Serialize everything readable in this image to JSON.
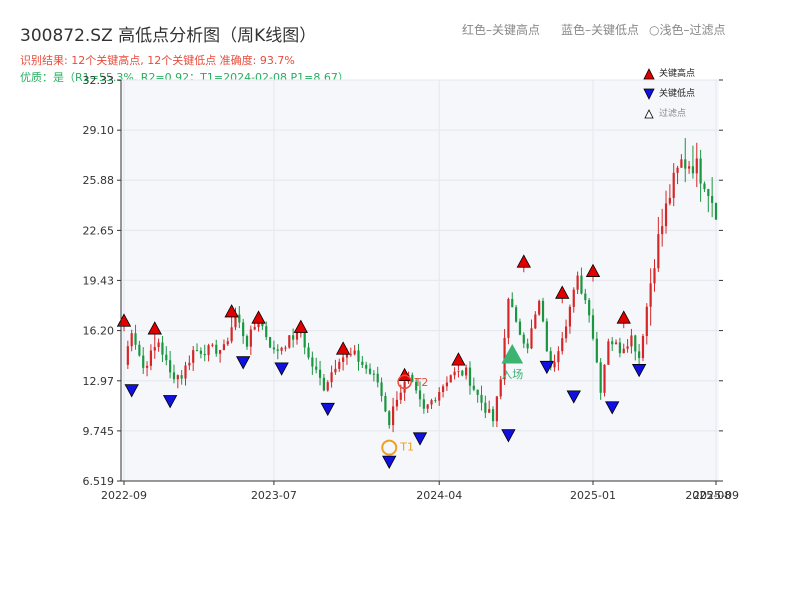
{
  "title": "300872.SZ 高低点分析图（周K线图）",
  "subtitle_result": "识别结果: 12个关键高点, 12个关键低点   准确度: 93.7%",
  "subtitle_quality": "优质：是（R1=55.3%, R2=0.92；T1=2024-02-08 P1=8.67）",
  "top_legend": {
    "red": "红色–关键高点",
    "blue": "蓝色–关键低点",
    "light": "○浅色–过滤点"
  },
  "legend": {
    "high": "关键高点",
    "low": "关键低点",
    "filtered": "过滤点"
  },
  "annotations": {
    "t1": "T1",
    "t2": "T2",
    "entry": "入场"
  },
  "colors": {
    "up": "#d62728",
    "down": "#1a9641",
    "high_marker": "#e00000",
    "low_marker": "#1010e0",
    "entry": "#3cb371",
    "t_marker": "#f0a020",
    "plot_bg": "#f5f7fa"
  },
  "chart_data": {
    "type": "candlestick",
    "x_ticks": [
      "2022-09",
      "2023-07",
      "2024-04",
      "2025-01",
      "2025-09"
    ],
    "y_ticks": [
      "6.519",
      "9.745",
      "12.97",
      "16.20",
      "19.43",
      "22.65",
      "25.88",
      "29.10",
      "32.33"
    ],
    "ylim": [
      6.519,
      32.33
    ],
    "weeks": 154,
    "close_path": [
      [
        0,
        14.0
      ],
      [
        2,
        16.3
      ],
      [
        5,
        13.8
      ],
      [
        9,
        15.5
      ],
      [
        12,
        13.4
      ],
      [
        15,
        13.3
      ],
      [
        18,
        14.9
      ],
      [
        26,
        15.0
      ],
      [
        29,
        17.2
      ],
      [
        32,
        15.4
      ],
      [
        35,
        17.0
      ],
      [
        39,
        14.8
      ],
      [
        46,
        16.2
      ],
      [
        48,
        14.4
      ],
      [
        52,
        12.6
      ],
      [
        56,
        14.5
      ],
      [
        60,
        14.6
      ],
      [
        66,
        12.9
      ],
      [
        69,
        10.3
      ],
      [
        71,
        12.0
      ],
      [
        74,
        13.1
      ],
      [
        78,
        11.0
      ],
      [
        85,
        13.4
      ],
      [
        89,
        13.5
      ],
      [
        92,
        12.0
      ],
      [
        96,
        10.4
      ],
      [
        98,
        13.0
      ],
      [
        100,
        18.5
      ],
      [
        102,
        16.5
      ],
      [
        105,
        15.3
      ],
      [
        108,
        18.0
      ],
      [
        111,
        13.6
      ],
      [
        115,
        16.8
      ],
      [
        118,
        19.5
      ],
      [
        121,
        17.5
      ],
      [
        124,
        12.5
      ],
      [
        126,
        15.7
      ],
      [
        129,
        15.0
      ],
      [
        132,
        15.8
      ],
      [
        134,
        14.5
      ],
      [
        138,
        21.0
      ],
      [
        142,
        25.0
      ],
      [
        145,
        27.0
      ],
      [
        148,
        27.0
      ],
      [
        151,
        26.0
      ],
      [
        154,
        24.1
      ]
    ],
    "key_highs": [
      {
        "week": 0,
        "price": 16.8
      },
      {
        "week": 8,
        "price": 16.3
      },
      {
        "week": 28,
        "price": 17.4
      },
      {
        "week": 35,
        "price": 17.0
      },
      {
        "week": 46,
        "price": 16.4
      },
      {
        "week": 57,
        "price": 15.0
      },
      {
        "week": 73,
        "price": 13.3
      },
      {
        "week": 87,
        "price": 14.3
      },
      {
        "week": 104,
        "price": 20.6
      },
      {
        "week": 114,
        "price": 18.6
      },
      {
        "week": 122,
        "price": 20.0
      },
      {
        "week": 130,
        "price": 17.0
      }
    ],
    "key_lows": [
      {
        "week": 2,
        "price": 12.4
      },
      {
        "week": 12,
        "price": 11.7
      },
      {
        "week": 31,
        "price": 14.2
      },
      {
        "week": 41,
        "price": 13.8
      },
      {
        "week": 53,
        "price": 11.2
      },
      {
        "week": 69,
        "price": 7.8
      },
      {
        "week": 77,
        "price": 9.3
      },
      {
        "week": 100,
        "price": 9.5
      },
      {
        "week": 110,
        "price": 13.9
      },
      {
        "week": 117,
        "price": 12.0
      },
      {
        "week": 127,
        "price": 11.3
      },
      {
        "week": 134,
        "price": 13.7
      }
    ],
    "t1": {
      "week": 69,
      "price": 8.67
    },
    "t2": {
      "week": 73,
      "price": 12.9
    },
    "entry": {
      "week": 101,
      "price": 14.5
    }
  }
}
